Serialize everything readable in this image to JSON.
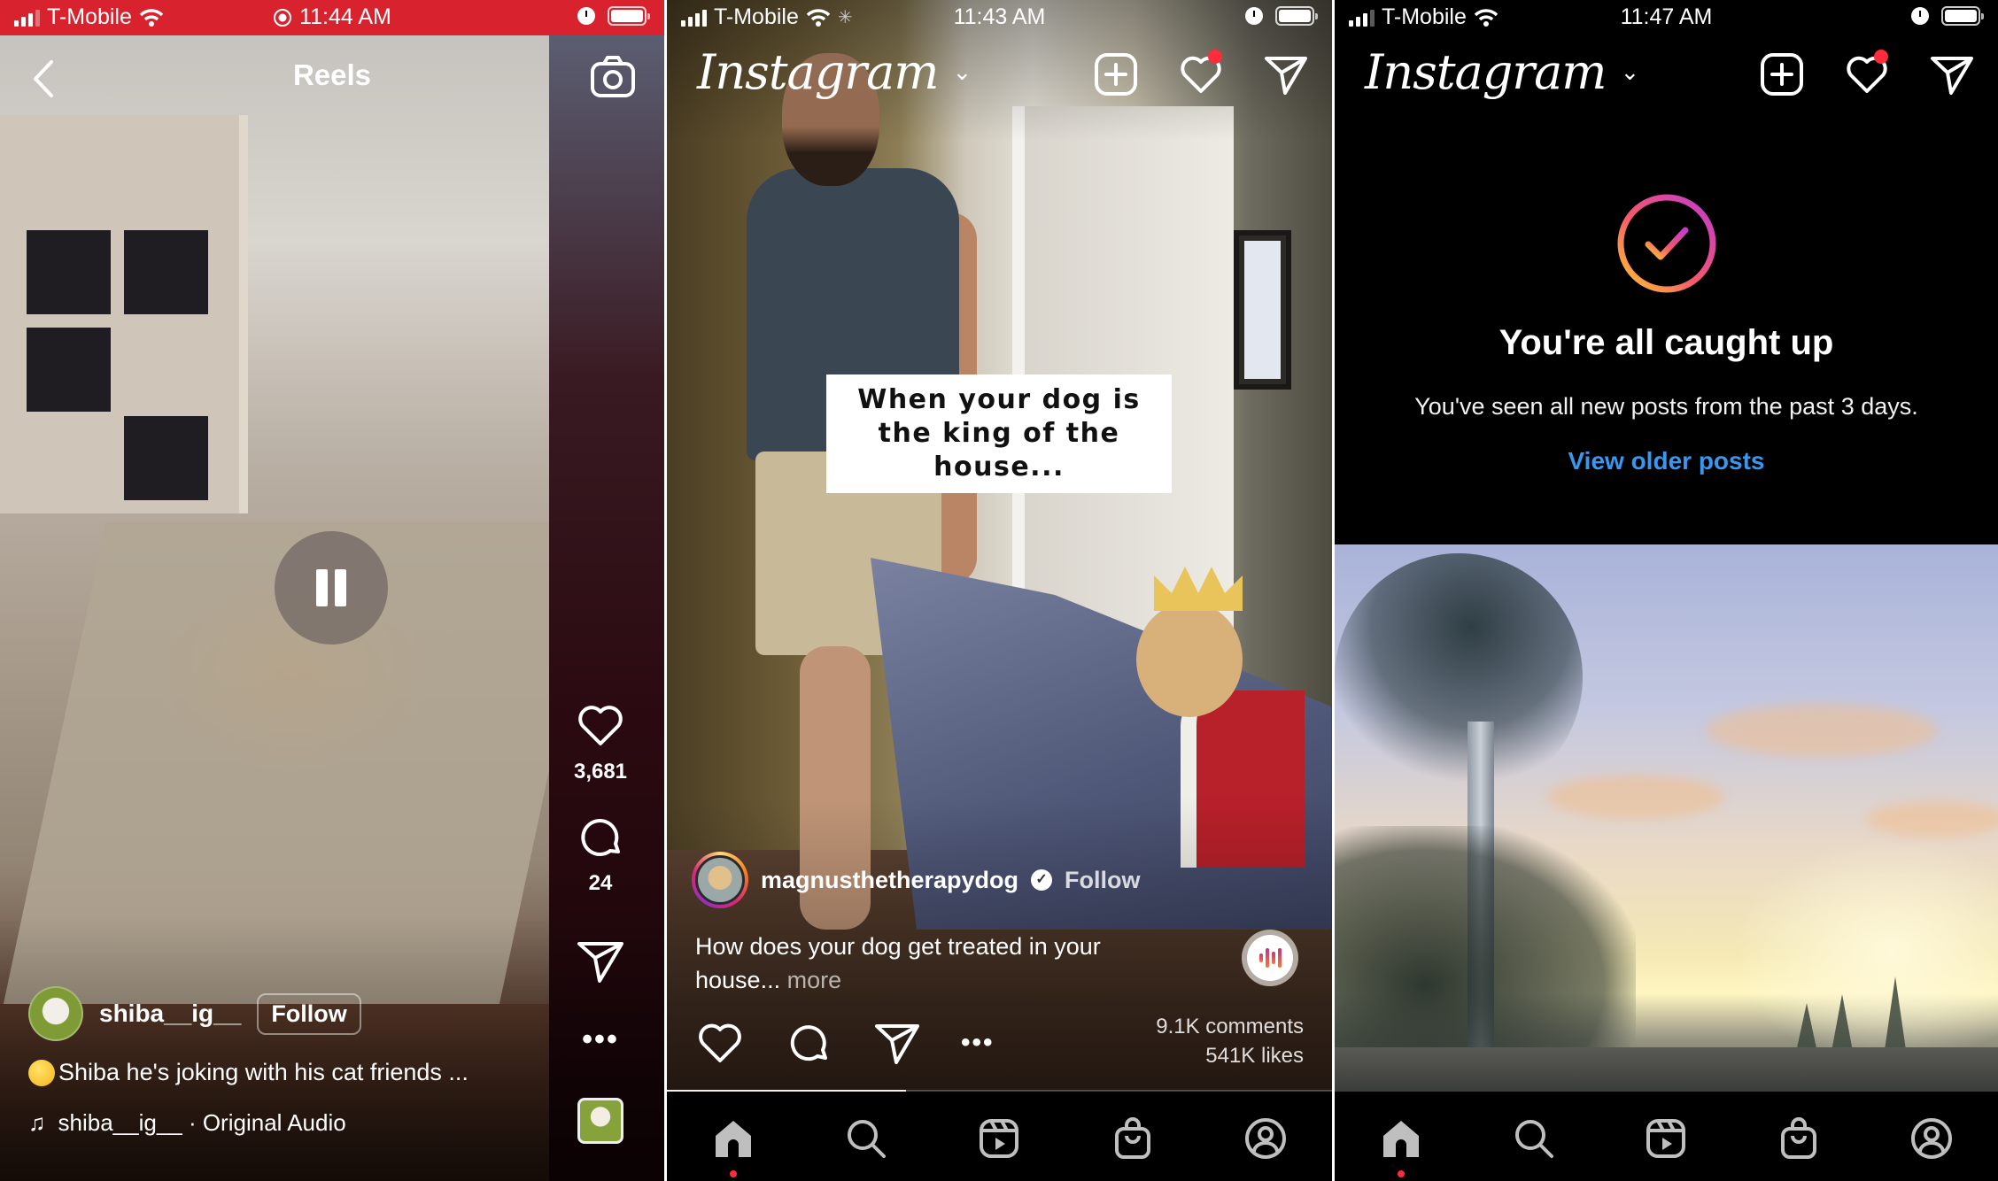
{
  "panels": [
    {
      "status": {
        "carrier": "T-Mobile",
        "time": "11:44 AM",
        "recording_indicator": "screen-recording-icon",
        "bar_color": "#d8232f"
      },
      "header": {
        "title": "Reels",
        "back_icon": "chevron-left-icon",
        "camera_icon": "camera-icon"
      },
      "player": {
        "state_icon": "pause-icon"
      },
      "actions": {
        "likes": "3,681",
        "comments": "24",
        "more": "•••"
      },
      "post": {
        "username": "shiba__ig__",
        "follow_label": "Follow",
        "caption": "Shiba he's joking with his cat friends ...",
        "caption_emoji": "yum-face-emoji",
        "audio": "shiba__ig__ · Original Audio",
        "audio_note": "♫"
      }
    },
    {
      "status": {
        "carrier": "T-Mobile",
        "time": "11:43 AM"
      },
      "header": {
        "logo": "Instagram",
        "chevron": "⌄"
      },
      "video_text": "When your dog is the king of the house...",
      "post": {
        "username": "magnusthetherapydog",
        "verified": true,
        "follow_label": "Follow",
        "caption": "How does your dog get treated in your house...",
        "more_label": "more",
        "comments": "9.1K comments",
        "likes": "541K likes",
        "more_actions": "•••",
        "video_progress": 0.36
      },
      "nav": [
        "home",
        "search",
        "reels",
        "shop",
        "profile"
      ],
      "nav_active": "home"
    },
    {
      "status": {
        "carrier": "T-Mobile",
        "time": "11:47 AM"
      },
      "header": {
        "logo": "Instagram",
        "chevron": "⌄"
      },
      "caught_up": {
        "title": "You're all caught up",
        "subtitle": "You've seen all new posts from the past 3 days.",
        "link": "View older posts"
      },
      "nav": [
        "home",
        "search",
        "reels",
        "shop",
        "profile"
      ],
      "nav_active": "home"
    }
  ],
  "colors": {
    "notification": "#ff2d3c",
    "link_blue": "#3897f0",
    "nav_icon": "#bfbfbf"
  }
}
